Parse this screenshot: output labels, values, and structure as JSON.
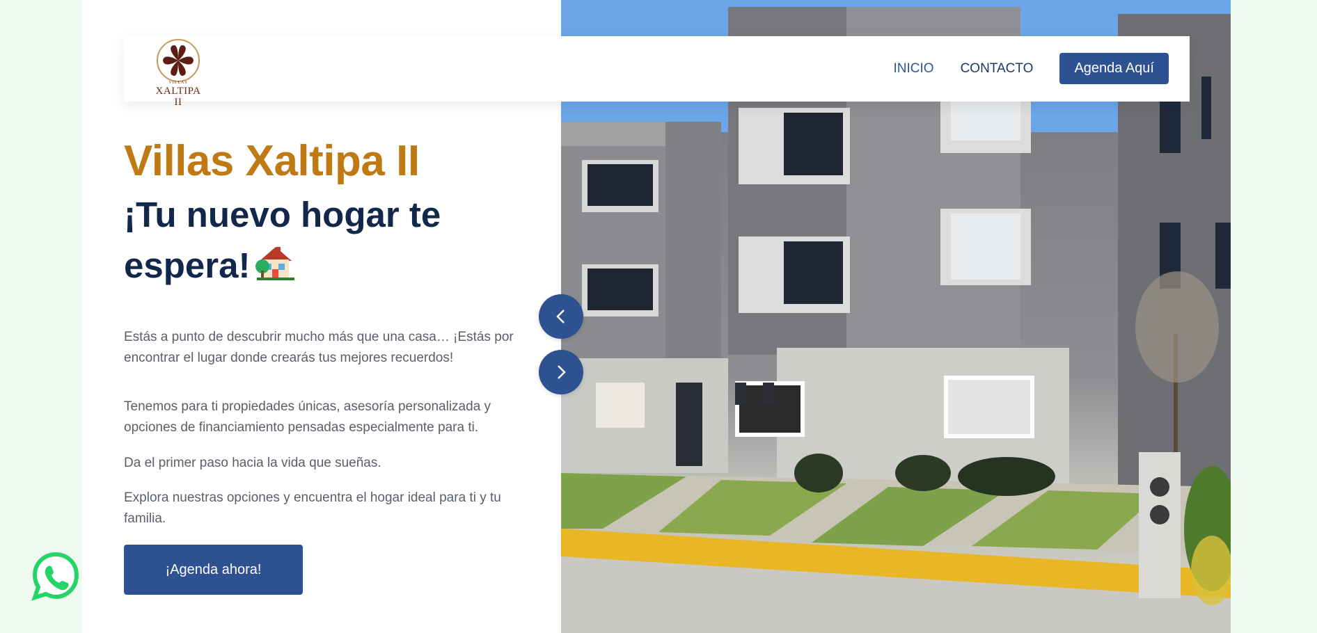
{
  "header": {
    "logo_small": "VILLAS",
    "logo_big": "XALTIPA II",
    "nav": [
      {
        "label": "INICIO"
      },
      {
        "label": "CONTACTO"
      }
    ],
    "cta_label": "Agenda Aquí"
  },
  "hero": {
    "brand": "Villas Xaltipa II",
    "headline": "¡Tu nuevo hogar te espera!",
    "paragraphs": [
      "Estás a punto de descubrir mucho más que una casa… ¡Estás por encontrar el lugar donde crearás tus mejores recuerdos!",
      "Tenemos para ti propiedades únicas, asesoría personalizada y opciones de financiamiento pensadas especialmente para ti.",
      "Da el primer paso hacia la vida que sueñas.",
      "Explora nuestras opciones y encuentra el hogar ideal para ti y tu familia."
    ],
    "cta_label": "¡Agenda ahora!"
  },
  "icons": {
    "prev": "chevron-left-icon",
    "next": "chevron-right-icon",
    "whatsapp": "whatsapp-icon",
    "house": "house-with-garden-icon"
  },
  "colors": {
    "brand_gold": "#c07a13",
    "navy": "#12284a",
    "button_blue": "#2e5191",
    "whatsapp_green": "#25d366",
    "page_bg": "#effbf1"
  }
}
